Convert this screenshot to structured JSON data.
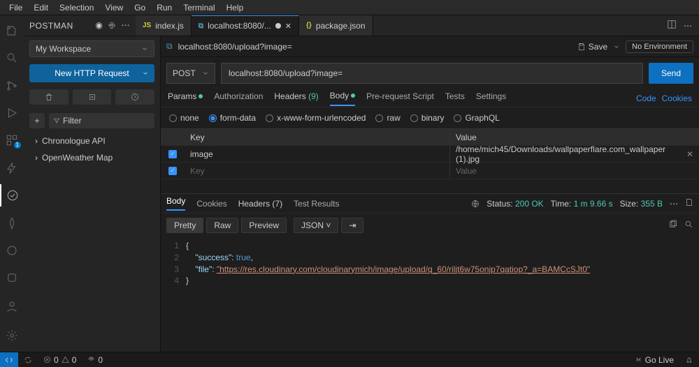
{
  "menubar": [
    "File",
    "Edit",
    "Selection",
    "View",
    "Go",
    "Run",
    "Terminal",
    "Help"
  ],
  "sidePanel": {
    "title": "POSTMAN"
  },
  "tabs": [
    {
      "icon": "JS",
      "iconColor": "#cbcb41",
      "label": "index.js",
      "active": false,
      "dirty": false
    },
    {
      "icon": "⧉",
      "iconColor": "#519aba",
      "label": "localhost:8080/...",
      "active": true,
      "dirty": true
    },
    {
      "icon": "{}",
      "iconColor": "#cbcb41",
      "label": "package.json",
      "active": false,
      "dirty": false
    }
  ],
  "workspace": "My Workspace",
  "newRequestBtn": "New HTTP Request",
  "filterPlaceholder": "Filter",
  "collections": [
    "Chronologue API",
    "OpenWeather Map"
  ],
  "saveLabel": "Save",
  "envLabel": "No Environment",
  "urlBreadcrumb": "localhost:8080/upload?image=",
  "method": "POST",
  "url": "localhost:8080/upload?image=",
  "sendLabel": "Send",
  "reqTabs": {
    "params": "Params",
    "auth": "Authorization",
    "headers": "Headers",
    "headersCount": "(9)",
    "body": "Body",
    "preReq": "Pre-request Script",
    "tests": "Tests",
    "settings": "Settings",
    "code": "Code",
    "cookies": "Cookies"
  },
  "bodyTypes": [
    "none",
    "form-data",
    "x-www-form-urlencoded",
    "raw",
    "binary",
    "GraphQL"
  ],
  "bodyTypeSelected": 1,
  "kvHeader": {
    "key": "Key",
    "value": "Value"
  },
  "kvRows": [
    {
      "checked": true,
      "key": "image",
      "value": "/home/mich45/Downloads/wallpaperflare.com_wallpaper (1).jpg"
    },
    {
      "checked": true,
      "key": "",
      "value": "",
      "placeholder_key": "Key",
      "placeholder_value": "Value"
    }
  ],
  "respTabs": {
    "body": "Body",
    "cookies": "Cookies",
    "headers": "Headers",
    "headersCount": "(7)",
    "tests": "Test Results"
  },
  "status": {
    "label": "Status:",
    "code": "200 OK",
    "timeLabel": "Time:",
    "time": "1 m 9.66 s",
    "sizeLabel": "Size:",
    "size": "355 B"
  },
  "viewModes": {
    "pretty": "Pretty",
    "raw": "Raw",
    "preview": "Preview",
    "format": "JSON"
  },
  "response": {
    "success_key": "\"success\"",
    "success_val": "true",
    "file_key": "\"file\"",
    "file_val": "\"https://res.cloudinary.com/cloudinarymich/image/upload/q_60/riljt6w75onjp7qatiop?_a=BAMCcSJt0\""
  },
  "statusBar": {
    "branch": "",
    "errors": "0",
    "warnings": "0",
    "ports": "0",
    "goLive": "Go Live"
  }
}
